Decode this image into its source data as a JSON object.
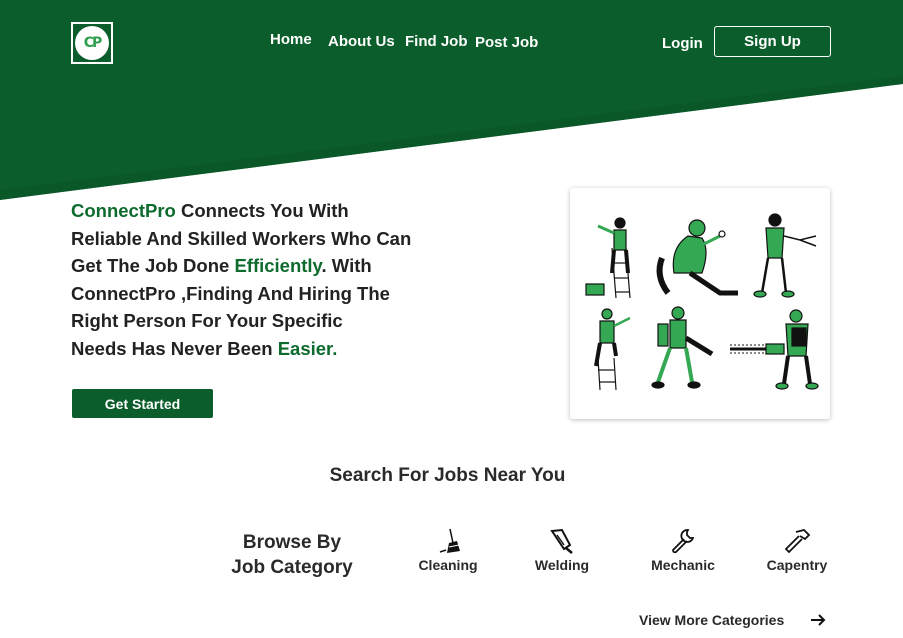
{
  "brand": {
    "logo_text": "CP",
    "colors": {
      "primary": "#0b5e2b",
      "accent_text": "#0e6b2e",
      "illustration_green": "#34a853"
    }
  },
  "nav": {
    "home": "Home",
    "about": "About Us",
    "find_job": "Find Job",
    "post_job": "Post Job",
    "login": "Login",
    "signup": "Sign Up"
  },
  "hero": {
    "l1_accent": "ConnectPro",
    "l1_rest": " Connects You With",
    "l2": "Reliable And Skilled Workers Who Can",
    "l3_start": "Get The Job Done ",
    "l3_accent": "Efficiently",
    "l3_end": ". With",
    "l4": "ConnectPro ,Finding And Hiring The",
    "l5": "Right Person  For Your Specific",
    "l6_start": "Needs Has Never Been ",
    "l6_accent": "Easier.",
    "cta": "Get Started"
  },
  "search": {
    "heading": "Search For Jobs Near You"
  },
  "browse": {
    "line1": "Browse By",
    "line2": "Job Category"
  },
  "categories": [
    {
      "label": "Cleaning",
      "icon": "broom-icon"
    },
    {
      "label": "Welding",
      "icon": "welding-torch-icon"
    },
    {
      "label": "Mechanic",
      "icon": "wrench-icon"
    },
    {
      "label": "Capentry",
      "icon": "hammer-icon"
    }
  ],
  "view_more": {
    "label": "View More Categories",
    "icon": "arrow-right-icon"
  }
}
